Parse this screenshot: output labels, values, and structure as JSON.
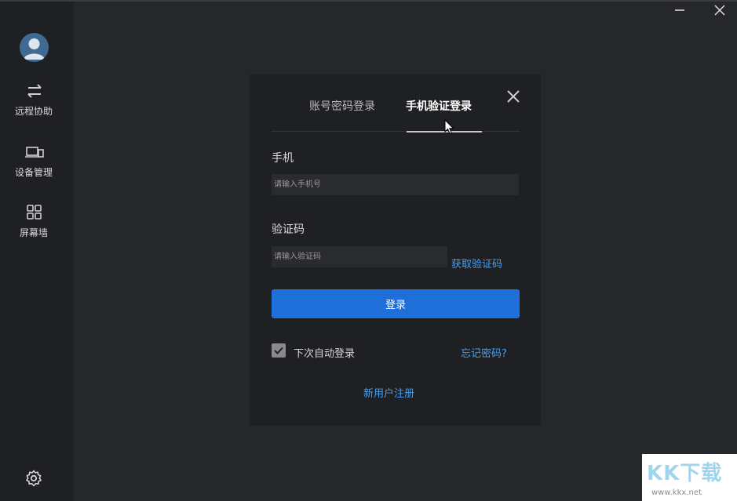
{
  "window": {
    "minimize_icon": "minimize-icon",
    "close_icon": "close-icon"
  },
  "sidebar": {
    "avatar_icon": "user-avatar-icon",
    "items": [
      {
        "label": "远程协助",
        "icon": "swap-arrows-icon"
      },
      {
        "label": "设备管理",
        "icon": "devices-icon"
      },
      {
        "label": "屏幕墙",
        "icon": "grid-icon"
      }
    ],
    "settings_icon": "gear-icon"
  },
  "dialog": {
    "tabs": [
      {
        "label": "账号密码登录",
        "active": false
      },
      {
        "label": "手机验证登录",
        "active": true
      }
    ],
    "phone_label": "手机",
    "phone_placeholder": "请输入手机号",
    "phone_value": "",
    "code_label": "验证码",
    "code_placeholder": "请输入验证码",
    "code_value": "",
    "get_code_label": "获取验证码",
    "login_label": "登录",
    "auto_login_label": "下次自动登录",
    "auto_login_checked": true,
    "forgot_label": "忘记密码?",
    "register_label": "新用户注册"
  },
  "colors": {
    "accent": "#1e6fd9",
    "link": "#4a9ff0",
    "background": "#26272b",
    "panel": "#1f2023"
  },
  "watermark": {
    "logo_text": "KK下载",
    "url": "www.kkx.net"
  }
}
